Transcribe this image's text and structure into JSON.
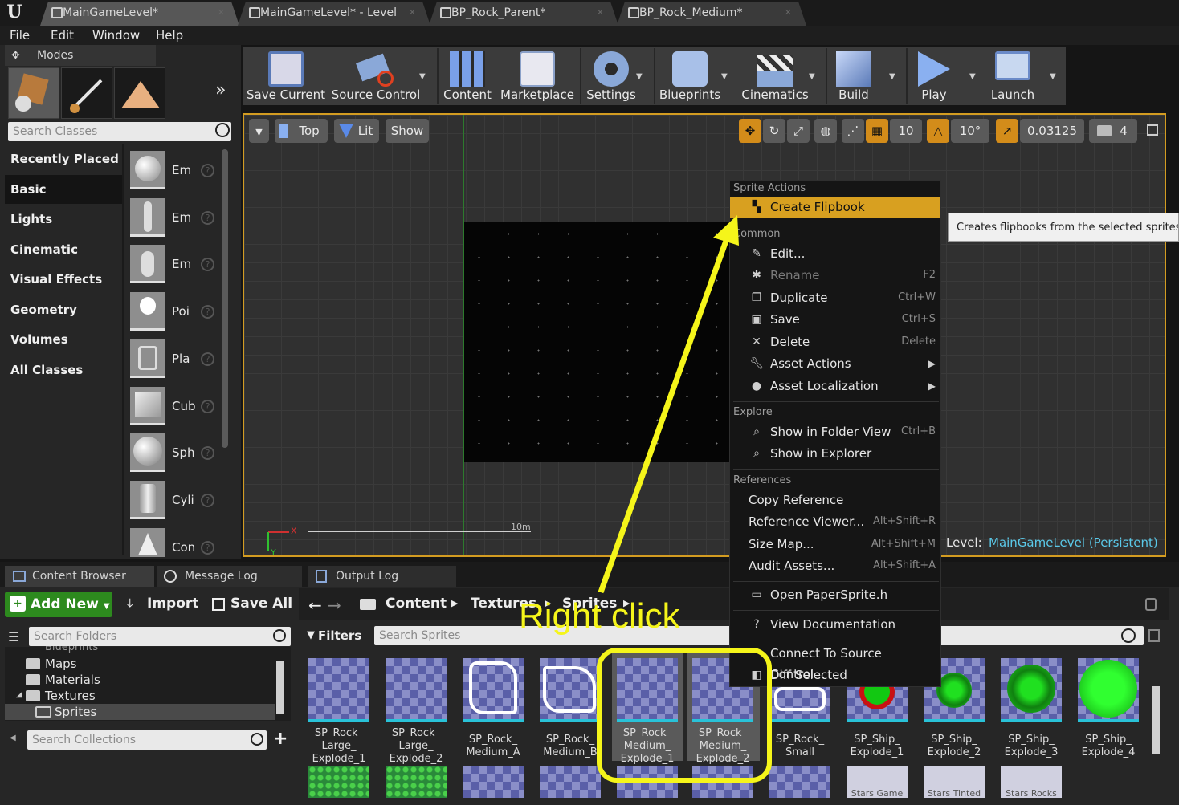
{
  "tabs": [
    "MainGameLevel*",
    "MainGameLevel* - Level",
    "BP_Rock_Parent*",
    "BP_Rock_Medium*"
  ],
  "menus": [
    "File",
    "Edit",
    "Window",
    "Help"
  ],
  "modes": {
    "title": "Modes",
    "search_placeholder": "Search Classes",
    "categories": [
      "Recently Placed",
      "Basic",
      "Lights",
      "Cinematic",
      "Visual Effects",
      "Geometry",
      "Volumes",
      "All Classes"
    ],
    "items": [
      "Em",
      "Em",
      "Em",
      "Poi",
      "Pla",
      "Cub",
      "Sph",
      "Cyli",
      "Con"
    ]
  },
  "toolbar": [
    "Save Current",
    "Source Control",
    "Content",
    "Marketplace",
    "Settings",
    "Blueprints",
    "Cinematics",
    "Build",
    "Play",
    "Launch"
  ],
  "viewport": {
    "view_mode": "Top",
    "lighting": "Lit",
    "show": "Show",
    "grid_snap": "10",
    "rot_snap": "10°",
    "scale_snap": "0.03125",
    "cam_speed": "4",
    "scale_label": "10m",
    "level_label": "Level:",
    "level_name": "MainGameLevel (Persistent)",
    "axis_x": "X",
    "axis_y": "Y"
  },
  "context_menu": {
    "sections": [
      "Sprite Actions",
      "Common",
      "Explore",
      "References"
    ],
    "items": [
      {
        "label": "Create Flipbook",
        "shortcut": ""
      },
      {
        "label": "Edit...",
        "shortcut": ""
      },
      {
        "label": "Rename",
        "shortcut": "F2"
      },
      {
        "label": "Duplicate",
        "shortcut": "Ctrl+W"
      },
      {
        "label": "Save",
        "shortcut": "Ctrl+S"
      },
      {
        "label": "Delete",
        "shortcut": "Delete"
      },
      {
        "label": "Asset Actions",
        "shortcut": ""
      },
      {
        "label": "Asset Localization",
        "shortcut": ""
      },
      {
        "label": "Show in Folder View",
        "shortcut": "Ctrl+B"
      },
      {
        "label": "Show in Explorer",
        "shortcut": ""
      },
      {
        "label": "Copy Reference",
        "shortcut": ""
      },
      {
        "label": "Reference Viewer...",
        "shortcut": "Alt+Shift+R"
      },
      {
        "label": "Size Map...",
        "shortcut": "Alt+Shift+M"
      },
      {
        "label": "Audit Assets...",
        "shortcut": "Alt+Shift+A"
      },
      {
        "label": "Open PaperSprite.h",
        "shortcut": ""
      },
      {
        "label": "View Documentation",
        "shortcut": ""
      },
      {
        "label": "Connect To Source Control...",
        "shortcut": ""
      },
      {
        "label": "Diff Selected",
        "shortcut": ""
      }
    ],
    "tooltip": "Creates flipbooks from the selected sprites"
  },
  "annotation": "Right click",
  "bottom_tabs": [
    "Content Browser",
    "Message Log",
    "Output Log"
  ],
  "content_browser": {
    "add_new": "Add New",
    "import": "Import",
    "save_all": "Save All",
    "path": [
      "Content",
      "Textures",
      "Sprites"
    ],
    "search_folders": "Search Folders",
    "folders": [
      "Maps",
      "Materials",
      "Textures",
      "Sprites"
    ],
    "folder_partial": "Blueprints",
    "search_collections": "Search Collections",
    "filters": "Filters",
    "search_assets": "Search Sprites",
    "assets": [
      [
        "SP_Rock_",
        "Large_",
        "Explode_1"
      ],
      [
        "SP_Rock_",
        "Large_",
        "Explode_2"
      ],
      [
        "SP_Rock_",
        "Medium_A"
      ],
      [
        "SP_Rock_",
        "Medium_B"
      ],
      [
        "SP_Rock_",
        "Medium_",
        "Explode_1"
      ],
      [
        "SP_Rock_",
        "Medium_",
        "Explode_2"
      ],
      [
        "SP_Rock_",
        "Small"
      ],
      [
        "SP_Ship_",
        "Explode_1"
      ],
      [
        "SP_Ship_",
        "Explode_2"
      ],
      [
        "SP_Ship_",
        "Explode_3"
      ],
      [
        "SP_Ship_",
        "Explode_4"
      ]
    ],
    "partial_row": [
      "Stars Game",
      "Stars Tinted",
      "Stars Rocks"
    ]
  },
  "colors": {
    "accent": "#d39c21",
    "highlight_item": "#d8a020",
    "annotation": "#f5f51a",
    "add_new": "#2d8a1e"
  }
}
